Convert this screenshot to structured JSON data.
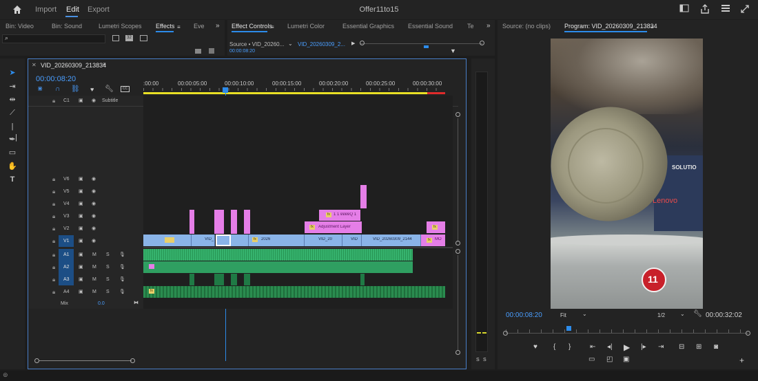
{
  "menu": {
    "home_icon": "home-icon",
    "import": "Import",
    "edit": "Edit",
    "export": "Export",
    "title": "Offer11to15"
  },
  "top_icons": [
    "layout-icon",
    "share-icon",
    "menu-icon",
    "fullscreen-icon"
  ],
  "project_panel": {
    "tabs": [
      "Bin: Video",
      "Bin: Sound",
      "Lumetri Scopes",
      "Effects",
      "Eve"
    ],
    "active_tab": "Effects",
    "search_placeholder": ""
  },
  "effect_controls": {
    "tabs": [
      "Effect Controls",
      "Lumetri Color",
      "Essential Graphics",
      "Essential Sound",
      "Te"
    ],
    "active_tab": "Effect Controls",
    "source_label": "Source • VID_20260...",
    "sequence_label": "VID_20260309_2...",
    "timecode": "00:00:08:20"
  },
  "monitor": {
    "source_tab": "Source: (no clips)",
    "program_tab": "Program: VID_20260309_213834",
    "timecode": "00:00:08:20",
    "fit": "Fit",
    "resolution": "1/2",
    "duration": "00:00:32:02",
    "badge": "11",
    "sign_text_1": "SOLUTIO",
    "sign_text_2": "Lenovo"
  },
  "timeline": {
    "sequence_name": "VID_20260309_213834",
    "timecode": "00:00:08:20",
    "ruler": [
      ":00:00",
      "00:00:05:00",
      "00:00:10:00",
      "00:00:15:00",
      "00:00:20:00",
      "00:00:25:00",
      "00:00:30:00"
    ],
    "subtitle_track": {
      "name": "C1",
      "label": "Subtitle"
    },
    "video_tracks": [
      "V6",
      "V5",
      "V4",
      "V3",
      "V2",
      "V1"
    ],
    "audio_tracks": [
      "A1",
      "A2",
      "A3",
      "A4"
    ],
    "mix_label": "Mix",
    "mix_value": "0.0",
    "m_label": "M",
    "s_label": "S",
    "clips": {
      "v1_labels": [
        "VID_",
        "2026",
        "VID_20",
        "VID",
        "VID_20260309_2144",
        "MO"
      ],
      "v3_label": "1 1 ɐɐɐɐQ 1",
      "v2_label": "Adjustment Layer",
      "fx": "fx"
    }
  },
  "meter": {
    "labels": [
      "S",
      "S"
    ]
  }
}
